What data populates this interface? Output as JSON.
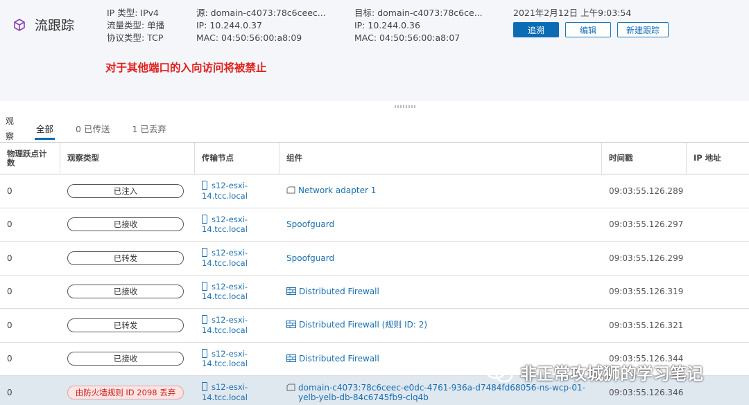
{
  "header": {
    "title": "流跟踪",
    "meta_col1": [
      "IP 类型: IPv4",
      "流量类型: 单播",
      "协议类型: TCP"
    ],
    "meta_col2": [
      "源: domain-c4073:78c6ceec...",
      "IP: 10.244.0.37",
      "MAC: 04:50:56:00:a8:09"
    ],
    "meta_col3": [
      "目标: domain-c4073:78c6ce...",
      "IP: 10.244.0.36",
      "MAC: 04:50:56:00:a8:07"
    ],
    "timestamp": "2021年2月12日 上午9:03:54",
    "buttons": {
      "trace": "追溯",
      "edit": "编辑",
      "new_trace": "新建跟踪"
    },
    "warning": "对于其他端口的入向访问将被禁止"
  },
  "observations": {
    "label": "观察",
    "tabs": [
      {
        "label": "全部",
        "active": true
      },
      {
        "label": "0 已传送",
        "active": false
      },
      {
        "label": "1 已丢弃",
        "active": false
      }
    ]
  },
  "table": {
    "headers": [
      "物理跃点计数",
      "观察类型",
      "传输节点",
      "组件",
      "时间戳",
      "IP 地址"
    ],
    "rows": [
      {
        "hop": "0",
        "type": "已注入",
        "node": [
          "s12-esxi-",
          "14.tcc.local"
        ],
        "component": [
          "Network adapter 1"
        ],
        "comp_icon": "vnic-icon",
        "time": "09:03:55.126.289",
        "danger": false
      },
      {
        "hop": "0",
        "type": "已接收",
        "node": [
          "s12-esxi-",
          "14.tcc.local"
        ],
        "component": [
          "Spoofguard"
        ],
        "comp_icon": "",
        "time": "09:03:55.126.297",
        "danger": false
      },
      {
        "hop": "0",
        "type": "已转发",
        "node": [
          "s12-esxi-",
          "14.tcc.local"
        ],
        "component": [
          "Spoofguard"
        ],
        "comp_icon": "",
        "time": "09:03:55.126.299",
        "danger": false
      },
      {
        "hop": "0",
        "type": "已接收",
        "node": [
          "s12-esxi-",
          "14.tcc.local"
        ],
        "component": [
          "Distributed Firewall"
        ],
        "comp_icon": "firewall-icon",
        "time": "09:03:55.126.319",
        "danger": false
      },
      {
        "hop": "0",
        "type": "已转发",
        "node": [
          "s12-esxi-",
          "14.tcc.local"
        ],
        "component": [
          "Distributed Firewall (规则 ID: 2)"
        ],
        "comp_icon": "firewall-icon",
        "time": "09:03:55.126.321",
        "danger": false
      },
      {
        "hop": "0",
        "type": "已接收",
        "node": [
          "s12-esxi-",
          "14.tcc.local"
        ],
        "component": [
          "Distributed Firewall"
        ],
        "comp_icon": "firewall-icon",
        "time": "09:03:55.126.344",
        "danger": false
      },
      {
        "hop": "0",
        "type": "由防火墙规则 ID 2098 丢弃",
        "node": [
          "s12-esxi-",
          "14.tcc.local"
        ],
        "component": [
          "domain-c4073:78c6ceec-e0dc-4761-936a-d7484fd68056-ns-wcp-01-",
          "yelb-yelb-db-84c6745fb9-clq4b"
        ],
        "comp_icon": "vnic-icon",
        "time": "09:03:55.126.346",
        "danger": true
      }
    ]
  },
  "watermark": {
    "text": "非正常攻城狮的学习笔记"
  },
  "colors": {
    "accent": "#0b6bb5",
    "link": "#1a6fb0",
    "danger": "#e0201c",
    "header_bg": "#f4f6fa",
    "highlight_row": "#dfe7ef"
  }
}
